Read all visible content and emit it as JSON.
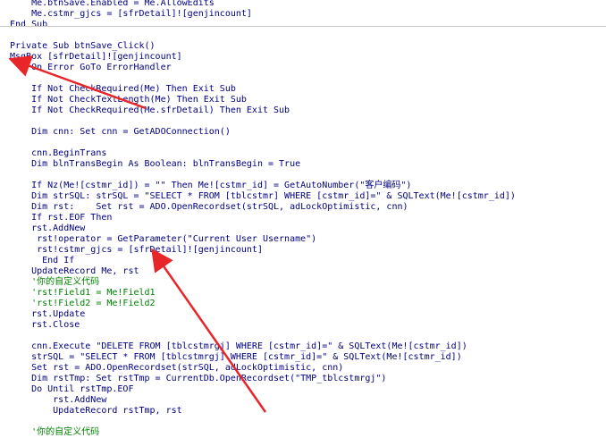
{
  "editor": {
    "lines": [
      {
        "text": "    Me.btnSave.Enabled = Me.AllowEdits",
        "type": "code"
      },
      {
        "text": "    Me.cstmr_gjcs = [sfrDetail]![genjincount]",
        "type": "code"
      },
      {
        "text": "End Sub",
        "type": "code"
      },
      {
        "text": "",
        "type": "code"
      },
      {
        "text": "Private Sub btnSave_Click()",
        "type": "code"
      },
      {
        "text": "MsgBox [sfrDetail]![genjincount]",
        "type": "code"
      },
      {
        "text": "    On Error GoTo ErrorHandler",
        "type": "code"
      },
      {
        "text": "",
        "type": "code"
      },
      {
        "text": "    If Not CheckRequired(Me) Then Exit Sub",
        "type": "code"
      },
      {
        "text": "    If Not CheckTextLength(Me) Then Exit Sub",
        "type": "code"
      },
      {
        "text": "    If Not CheckRequired(Me.sfrDetail) Then Exit Sub",
        "type": "code"
      },
      {
        "text": "",
        "type": "code"
      },
      {
        "text": "    Dim cnn: Set cnn = GetADOConnection()",
        "type": "code"
      },
      {
        "text": "",
        "type": "code"
      },
      {
        "text": "    cnn.BeginTrans",
        "type": "code"
      },
      {
        "text": "    Dim blnTransBegin As Boolean: blnTransBegin = True",
        "type": "code"
      },
      {
        "text": "",
        "type": "code"
      },
      {
        "text": "    If Nz(Me![cstmr_id]) = \"\" Then Me![cstmr_id] = GetAutoNumber(\"客户编码\")",
        "type": "code"
      },
      {
        "text": "    Dim strSQL: strSQL = \"SELECT * FROM [tblcstmr] WHERE [cstmr_id]=\" & SQLText(Me![cstmr_id])",
        "type": "code"
      },
      {
        "text": "    Dim rst:    Set rst = ADO.OpenRecordset(strSQL, adLockOptimistic, cnn)",
        "type": "code"
      },
      {
        "text": "    If rst.EOF Then",
        "type": "code"
      },
      {
        "text": "    rst.AddNew",
        "type": "code"
      },
      {
        "text": "     rst!operator = GetParameter(\"Current User Username\")",
        "type": "code"
      },
      {
        "text": "     rst!cstmr_gjcs = [sfrDetail]![genjincount]",
        "type": "code"
      },
      {
        "text": "      End If",
        "type": "code"
      },
      {
        "text": "    UpdateRecord Me, rst",
        "type": "code"
      },
      {
        "text": "    '你的自定义代码",
        "type": "comment"
      },
      {
        "text": "    'rst!Field1 = Me!Field1",
        "type": "comment"
      },
      {
        "text": "    'rst!Field2 = Me!Field2",
        "type": "comment"
      },
      {
        "text": "    rst.Update",
        "type": "code"
      },
      {
        "text": "    rst.Close",
        "type": "code"
      },
      {
        "text": "",
        "type": "code"
      },
      {
        "text": "    cnn.Execute \"DELETE FROM [tblcstmrgj] WHERE [cstmr_id]=\" & SQLText(Me![cstmr_id])",
        "type": "code"
      },
      {
        "text": "    strSQL = \"SELECT * FROM [tblcstmrgj] WHERE [cstmr_id]=\" & SQLText(Me![cstmr_id])",
        "type": "code"
      },
      {
        "text": "    Set rst = ADO.OpenRecordset(strSQL, adLockOptimistic, cnn)",
        "type": "code"
      },
      {
        "text": "    Dim rstTmp: Set rstTmp = CurrentDb.OpenRecordset(\"TMP_tblcstmrgj\")",
        "type": "code"
      },
      {
        "text": "    Do Until rstTmp.EOF",
        "type": "code"
      },
      {
        "text": "        rst.AddNew",
        "type": "code"
      },
      {
        "text": "        UpdateRecord rstTmp, rst",
        "type": "code"
      },
      {
        "text": "",
        "type": "code"
      },
      {
        "text": "    '你的自定义代码",
        "type": "comment"
      }
    ]
  },
  "colors": {
    "code": "#000080",
    "comment": "#008000",
    "arrow": "#e8262a",
    "separator": "#c8c8c8",
    "background": "#ffffff"
  },
  "icons": [
    "red-annotation-arrow"
  ]
}
